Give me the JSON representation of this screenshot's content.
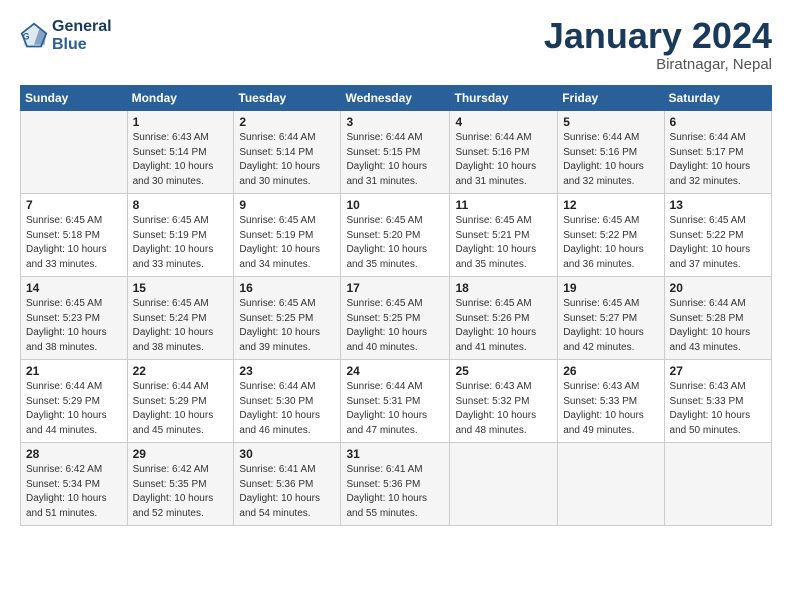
{
  "header": {
    "logo_line1": "General",
    "logo_line2": "Blue",
    "title": "January 2024",
    "location": "Biratnagar, Nepal"
  },
  "columns": [
    "Sunday",
    "Monday",
    "Tuesday",
    "Wednesday",
    "Thursday",
    "Friday",
    "Saturday"
  ],
  "rows": [
    [
      {
        "day": "",
        "info": ""
      },
      {
        "day": "1",
        "info": "Sunrise: 6:43 AM\nSunset: 5:14 PM\nDaylight: 10 hours\nand 30 minutes."
      },
      {
        "day": "2",
        "info": "Sunrise: 6:44 AM\nSunset: 5:14 PM\nDaylight: 10 hours\nand 30 minutes."
      },
      {
        "day": "3",
        "info": "Sunrise: 6:44 AM\nSunset: 5:15 PM\nDaylight: 10 hours\nand 31 minutes."
      },
      {
        "day": "4",
        "info": "Sunrise: 6:44 AM\nSunset: 5:16 PM\nDaylight: 10 hours\nand 31 minutes."
      },
      {
        "day": "5",
        "info": "Sunrise: 6:44 AM\nSunset: 5:16 PM\nDaylight: 10 hours\nand 32 minutes."
      },
      {
        "day": "6",
        "info": "Sunrise: 6:44 AM\nSunset: 5:17 PM\nDaylight: 10 hours\nand 32 minutes."
      }
    ],
    [
      {
        "day": "7",
        "info": "Sunrise: 6:45 AM\nSunset: 5:18 PM\nDaylight: 10 hours\nand 33 minutes."
      },
      {
        "day": "8",
        "info": "Sunrise: 6:45 AM\nSunset: 5:19 PM\nDaylight: 10 hours\nand 33 minutes."
      },
      {
        "day": "9",
        "info": "Sunrise: 6:45 AM\nSunset: 5:19 PM\nDaylight: 10 hours\nand 34 minutes."
      },
      {
        "day": "10",
        "info": "Sunrise: 6:45 AM\nSunset: 5:20 PM\nDaylight: 10 hours\nand 35 minutes."
      },
      {
        "day": "11",
        "info": "Sunrise: 6:45 AM\nSunset: 5:21 PM\nDaylight: 10 hours\nand 35 minutes."
      },
      {
        "day": "12",
        "info": "Sunrise: 6:45 AM\nSunset: 5:22 PM\nDaylight: 10 hours\nand 36 minutes."
      },
      {
        "day": "13",
        "info": "Sunrise: 6:45 AM\nSunset: 5:22 PM\nDaylight: 10 hours\nand 37 minutes."
      }
    ],
    [
      {
        "day": "14",
        "info": "Sunrise: 6:45 AM\nSunset: 5:23 PM\nDaylight: 10 hours\nand 38 minutes."
      },
      {
        "day": "15",
        "info": "Sunrise: 6:45 AM\nSunset: 5:24 PM\nDaylight: 10 hours\nand 38 minutes."
      },
      {
        "day": "16",
        "info": "Sunrise: 6:45 AM\nSunset: 5:25 PM\nDaylight: 10 hours\nand 39 minutes."
      },
      {
        "day": "17",
        "info": "Sunrise: 6:45 AM\nSunset: 5:25 PM\nDaylight: 10 hours\nand 40 minutes."
      },
      {
        "day": "18",
        "info": "Sunrise: 6:45 AM\nSunset: 5:26 PM\nDaylight: 10 hours\nand 41 minutes."
      },
      {
        "day": "19",
        "info": "Sunrise: 6:45 AM\nSunset: 5:27 PM\nDaylight: 10 hours\nand 42 minutes."
      },
      {
        "day": "20",
        "info": "Sunrise: 6:44 AM\nSunset: 5:28 PM\nDaylight: 10 hours\nand 43 minutes."
      }
    ],
    [
      {
        "day": "21",
        "info": "Sunrise: 6:44 AM\nSunset: 5:29 PM\nDaylight: 10 hours\nand 44 minutes."
      },
      {
        "day": "22",
        "info": "Sunrise: 6:44 AM\nSunset: 5:29 PM\nDaylight: 10 hours\nand 45 minutes."
      },
      {
        "day": "23",
        "info": "Sunrise: 6:44 AM\nSunset: 5:30 PM\nDaylight: 10 hours\nand 46 minutes."
      },
      {
        "day": "24",
        "info": "Sunrise: 6:44 AM\nSunset: 5:31 PM\nDaylight: 10 hours\nand 47 minutes."
      },
      {
        "day": "25",
        "info": "Sunrise: 6:43 AM\nSunset: 5:32 PM\nDaylight: 10 hours\nand 48 minutes."
      },
      {
        "day": "26",
        "info": "Sunrise: 6:43 AM\nSunset: 5:33 PM\nDaylight: 10 hours\nand 49 minutes."
      },
      {
        "day": "27",
        "info": "Sunrise: 6:43 AM\nSunset: 5:33 PM\nDaylight: 10 hours\nand 50 minutes."
      }
    ],
    [
      {
        "day": "28",
        "info": "Sunrise: 6:42 AM\nSunset: 5:34 PM\nDaylight: 10 hours\nand 51 minutes."
      },
      {
        "day": "29",
        "info": "Sunrise: 6:42 AM\nSunset: 5:35 PM\nDaylight: 10 hours\nand 52 minutes."
      },
      {
        "day": "30",
        "info": "Sunrise: 6:41 AM\nSunset: 5:36 PM\nDaylight: 10 hours\nand 54 minutes."
      },
      {
        "day": "31",
        "info": "Sunrise: 6:41 AM\nSunset: 5:36 PM\nDaylight: 10 hours\nand 55 minutes."
      },
      {
        "day": "",
        "info": ""
      },
      {
        "day": "",
        "info": ""
      },
      {
        "day": "",
        "info": ""
      }
    ]
  ]
}
